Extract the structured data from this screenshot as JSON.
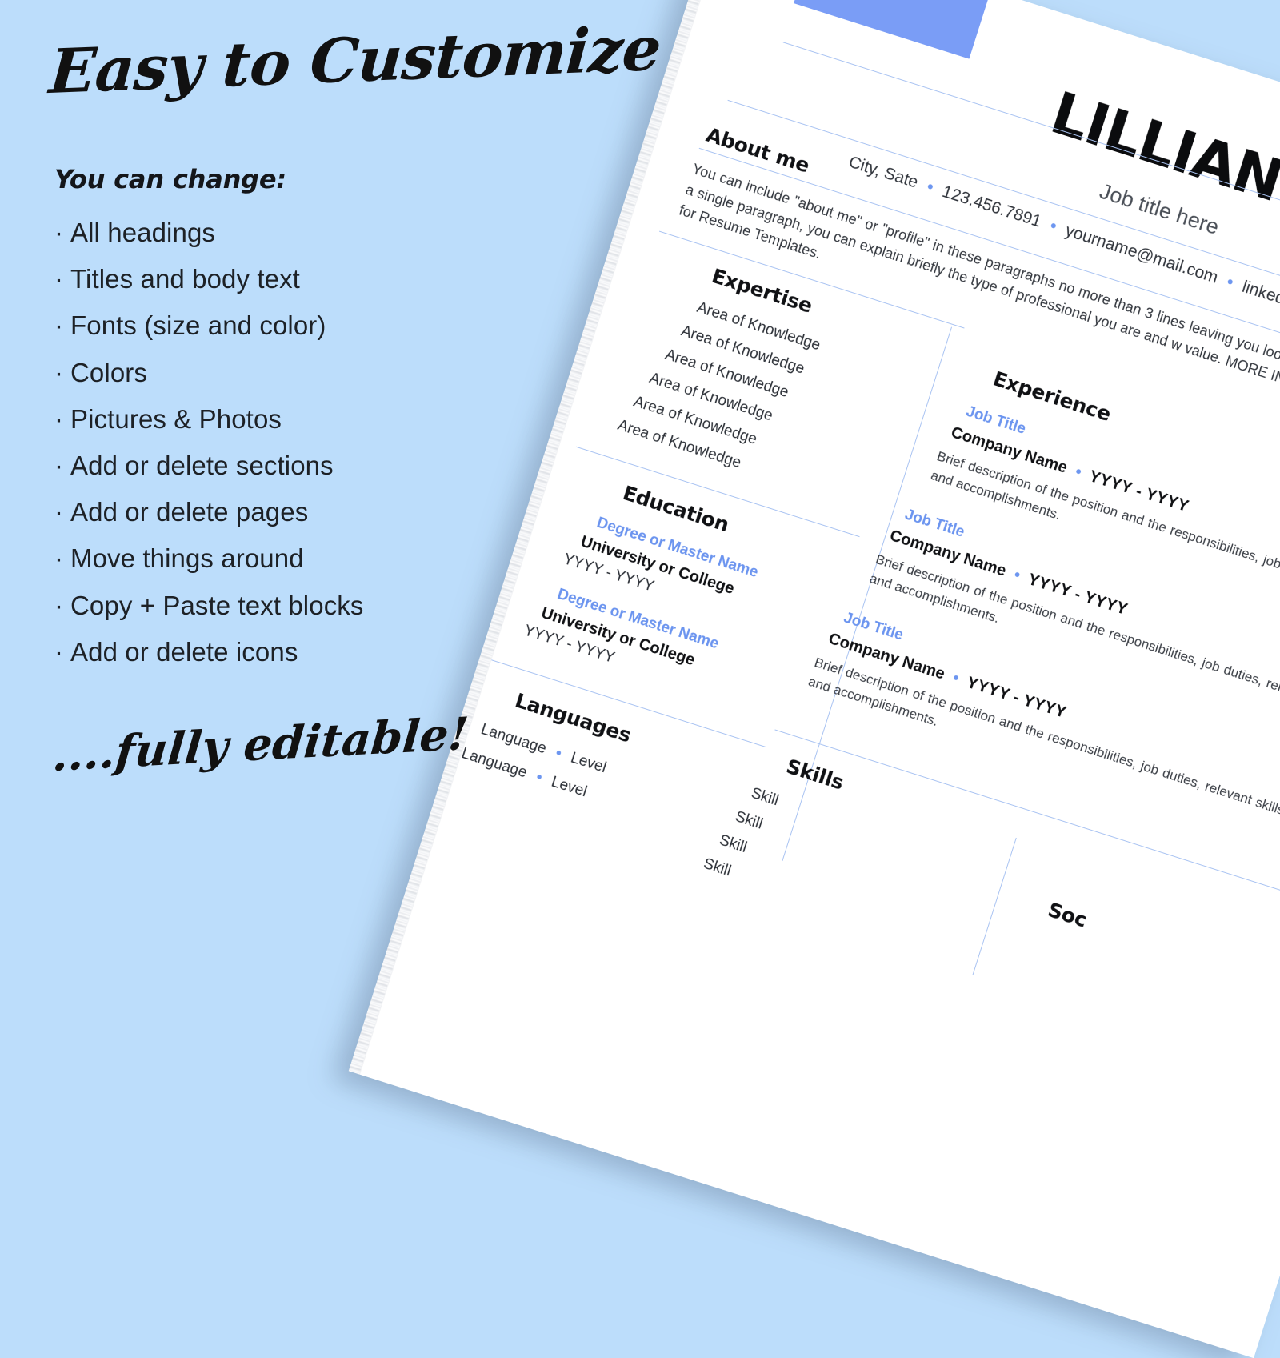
{
  "theme": {
    "background": "#bcddfb",
    "accent_blue": "#7a9df6",
    "text_blue": "#6b94ef",
    "rule_blue": "#a9c3f2",
    "paper": "#ffffff",
    "ink": "#1d2126"
  },
  "promo": {
    "headline": "Easy to Customize",
    "subhead": "You can change:",
    "bullets": [
      "All headings",
      "Titles and body text",
      "Fonts (size and color)",
      "Colors",
      "Pictures & Photos",
      "Add or delete sections",
      "Add or delete pages",
      "Move things around",
      "Copy + Paste text blocks",
      "Add or delete icons"
    ],
    "footline": "....fully editable!"
  },
  "resume": {
    "name": "LILLIAN ADAMS",
    "job_title": "Job title here",
    "contact": {
      "location": "City, Sate",
      "phone": "123.456.7891",
      "email": "yourname@mail.com",
      "linkedin": "linkedin.com/usern",
      "separator": "•"
    },
    "about": {
      "heading": "About me",
      "text": "You can include \"about me\" or \"profile\" in these paragraphs no more than 3 lines leaving you looking you are seeing but in a single paragraph, you can explain briefly the type of professional you are and w value. MORE INFO in Instructions Guide for Resume Templates."
    },
    "expertise": {
      "heading": "Expertise",
      "items": [
        "Area of Knowledge",
        "Area of Knowledge",
        "Area of Knowledge",
        "Area of Knowledge",
        "Area of Knowledge",
        "Area of Knowledge"
      ]
    },
    "education": {
      "heading": "Education",
      "entries": [
        {
          "degree": "Degree or Master Name",
          "school": "University or College",
          "years": "YYYY - YYYY"
        },
        {
          "degree": "Degree or Master Name",
          "school": "University or College",
          "years": "YYYY - YYYY"
        }
      ]
    },
    "languages": {
      "heading": "Languages",
      "entries": [
        {
          "name": "Language",
          "level": "Level"
        },
        {
          "name": "Language",
          "level": "Level"
        }
      ]
    },
    "experience": {
      "heading": "Experience",
      "entries": [
        {
          "job_title": "Job Title",
          "company": "Company Name",
          "years": "YYYY - YYYY",
          "description": "Brief description of the position and the responsibilities, job duties, relevant skills, and accomplishments."
        },
        {
          "job_title": "Job Title",
          "company": "Company Name",
          "years": "YYYY - YYYY",
          "description": "Brief description of the position and the responsibilities, job duties, relevant skills, and accomplishments."
        },
        {
          "job_title": "Job Title",
          "company": "Company Name",
          "years": "YYYY - YYYY",
          "description": "Brief description of the position and the responsibilities, job duties, relevant skills, and accomplishments."
        }
      ]
    },
    "skills": {
      "heading": "Skills",
      "items": [
        "Skill",
        "Skill",
        "Skill",
        "Skill"
      ]
    },
    "social": {
      "heading": "Soc"
    }
  }
}
